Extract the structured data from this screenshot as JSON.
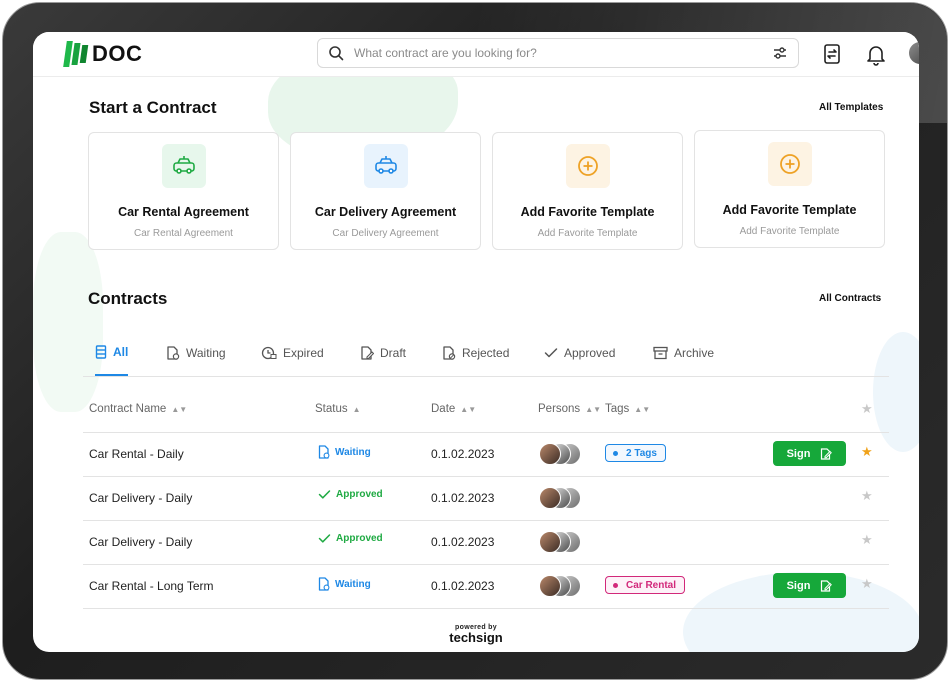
{
  "header": {
    "logo_text": "DOC",
    "search_placeholder": "What contract are you looking for?",
    "icons": [
      "search-icon",
      "filter-icon",
      "sync-icon",
      "bell-icon",
      "avatar"
    ]
  },
  "start_section": {
    "title": "Start a Contract",
    "all_link": "All Templates",
    "cards": [
      {
        "title": "Car Rental Agreement",
        "subtitle": "Car Rental Agreement",
        "icon": "car-icon"
      },
      {
        "title": "Car Delivery Agreement",
        "subtitle": "Car Delivery Agreement",
        "icon": "car-icon"
      },
      {
        "title": "Add Favorite Template",
        "subtitle": "Add Favorite Template",
        "icon": "plus-circle-icon"
      },
      {
        "title": "Add Favorite Template",
        "subtitle": "Add Favorite Template",
        "icon": "plus-circle-icon"
      }
    ]
  },
  "contracts_section": {
    "title": "Contracts",
    "all_link": "All Contracts",
    "tabs": [
      {
        "label": "All",
        "active": true
      },
      {
        "label": "Waiting"
      },
      {
        "label": "Expired"
      },
      {
        "label": "Draft"
      },
      {
        "label": "Rejected"
      },
      {
        "label": "Approved"
      },
      {
        "label": "Archive"
      }
    ],
    "columns": [
      "Contract Name",
      "Status",
      "Date",
      "Persons",
      "Tags"
    ],
    "rows": [
      {
        "name": "Car Rental - Daily",
        "status": "Waiting",
        "date": "0.1.02.2023",
        "tag": "2 Tags",
        "sign": "Sign",
        "favorite": true
      },
      {
        "name": "Car Delivery - Daily",
        "status": "Approved",
        "date": "0.1.02.2023",
        "tag": "",
        "sign": "",
        "favorite": false
      },
      {
        "name": "Car Delivery - Daily",
        "status": "Approved",
        "date": "0.1.02.2023",
        "tag": "",
        "sign": "",
        "favorite": false
      },
      {
        "name": "Car Rental - Long Term",
        "status": "Waiting",
        "date": "0.1.02.2023",
        "tag": "Car Rental",
        "sign": "Sign",
        "favorite": false
      }
    ]
  },
  "footer": {
    "powered_by": "powered by",
    "brand": "techsign"
  },
  "colors": {
    "accent_blue": "#1e88e5",
    "green": "#16a83a",
    "pink_tag": "#d2287a",
    "star": "#f0a21a"
  }
}
